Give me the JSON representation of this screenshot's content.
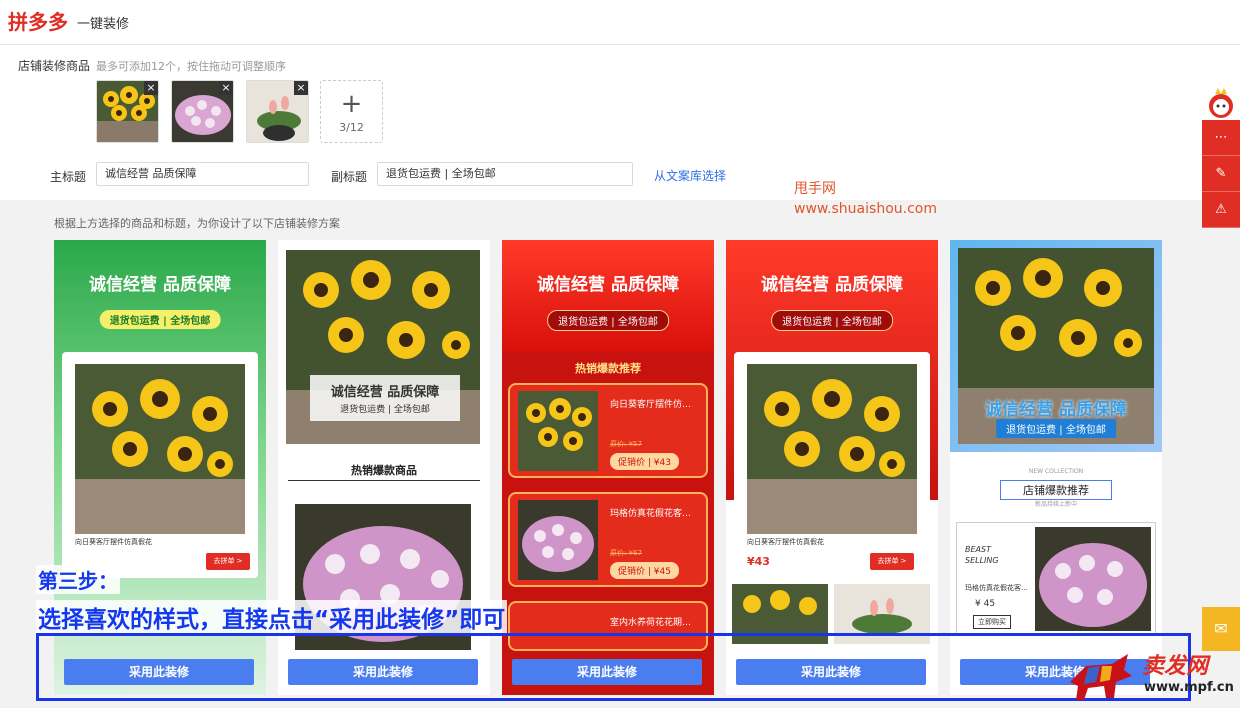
{
  "header": {
    "logo": "拼多多",
    "subtitle": "一键装修"
  },
  "products": {
    "label": "店铺装修商品",
    "hint": "最多可添加12个，按住拖动可调整顺序",
    "close_icon": "×",
    "add_icon": "+",
    "count": "3/12"
  },
  "titles": {
    "main_label": "主标题",
    "main_value": "诚信经营  品质保障",
    "sub_label": "副标题",
    "sub_value": "退货包运费 | 全场包邮",
    "library_link": "从文案库选择"
  },
  "watermark": {
    "line1": "甩手网",
    "line2": "www.shuaishou.com"
  },
  "design_hint": "根据上方选择的商品和标题，为你设计了以下店铺装修方案",
  "cards": {
    "apply_label": "采用此装修",
    "title": "诚信经营 品质保障",
    "subtitle": "退货包运费 | 全场包邮",
    "c1": {
      "product": "向日葵客厅摆件仿真假花",
      "buy": "去拼单 >"
    },
    "c2": {
      "section": "热销爆款商品"
    },
    "c3": {
      "section": "热销爆款推荐",
      "p1_name": "向日葵客厅摆件仿…",
      "p1_orig": "原价: ¥57",
      "p1_promo": "促销价 | ¥43",
      "p2_name": "玛格仿真花假花客…",
      "p2_orig": "原价: ¥67",
      "p2_promo": "促销价 | ¥45",
      "p3_name": "室内水养荷花花期…"
    },
    "c4": {
      "product": "向日葵客厅摆件仿真假花",
      "price": "¥43",
      "buy": "去拼单 >"
    },
    "c5": {
      "collection": "NEW COLLECTION",
      "section": "店铺爆款推荐",
      "section_sub": "新品持续上新中",
      "beast": "BEAST",
      "selling": "SELLING",
      "product": "玛格仿真花假花客…",
      "price": "¥ 45",
      "buy": "立即购买"
    }
  },
  "side_icons": [
    "chat-icon",
    "edit-icon",
    "warning-icon"
  ],
  "overlay": {
    "step": "第三步：",
    "instruction": "选择喜欢的样式，直接点击“采用此装修”即可"
  },
  "corner_logo": {
    "brand": "卖发网",
    "url": "www.mpf.cn"
  },
  "colors": {
    "brand_red": "#e02e24",
    "link_blue": "#2f6fe8",
    "apply_blue": "#4a7df0",
    "frame_blue": "#1a35e8"
  }
}
